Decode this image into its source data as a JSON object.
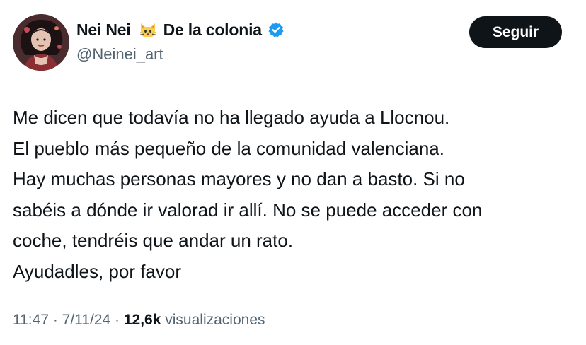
{
  "author": {
    "display_name": "Nei Nei",
    "name_suffix": "De la colonia",
    "name_emoji": "cat-face-icon",
    "verified_icon": "verified-badge-icon",
    "handle": "@Neinei_art",
    "avatar": "avatar-illustration"
  },
  "follow_button": {
    "label": "Seguir"
  },
  "tweet": {
    "lines": [
      "Me dicen que todavía no ha llegado ayuda a Llocnou.",
      "El pueblo más pequeño de la comunidad valenciana.",
      "Hay muchas personas mayores y no dan a basto. Si no",
      "sabéis a dónde ir valorad ir allí. No se puede acceder con",
      "coche, tendréis que andar un rato.",
      "Ayudadles, por favor"
    ]
  },
  "meta": {
    "time": "11:47",
    "separator": " · ",
    "date": "7/11/24",
    "views_count": "12,6k",
    "views_label": "visualizaciones"
  },
  "colors": {
    "text": "#0f1419",
    "secondary": "#536471",
    "verified": "#1d9bf0",
    "button_bg": "#0f1419",
    "button_text": "#ffffff"
  }
}
